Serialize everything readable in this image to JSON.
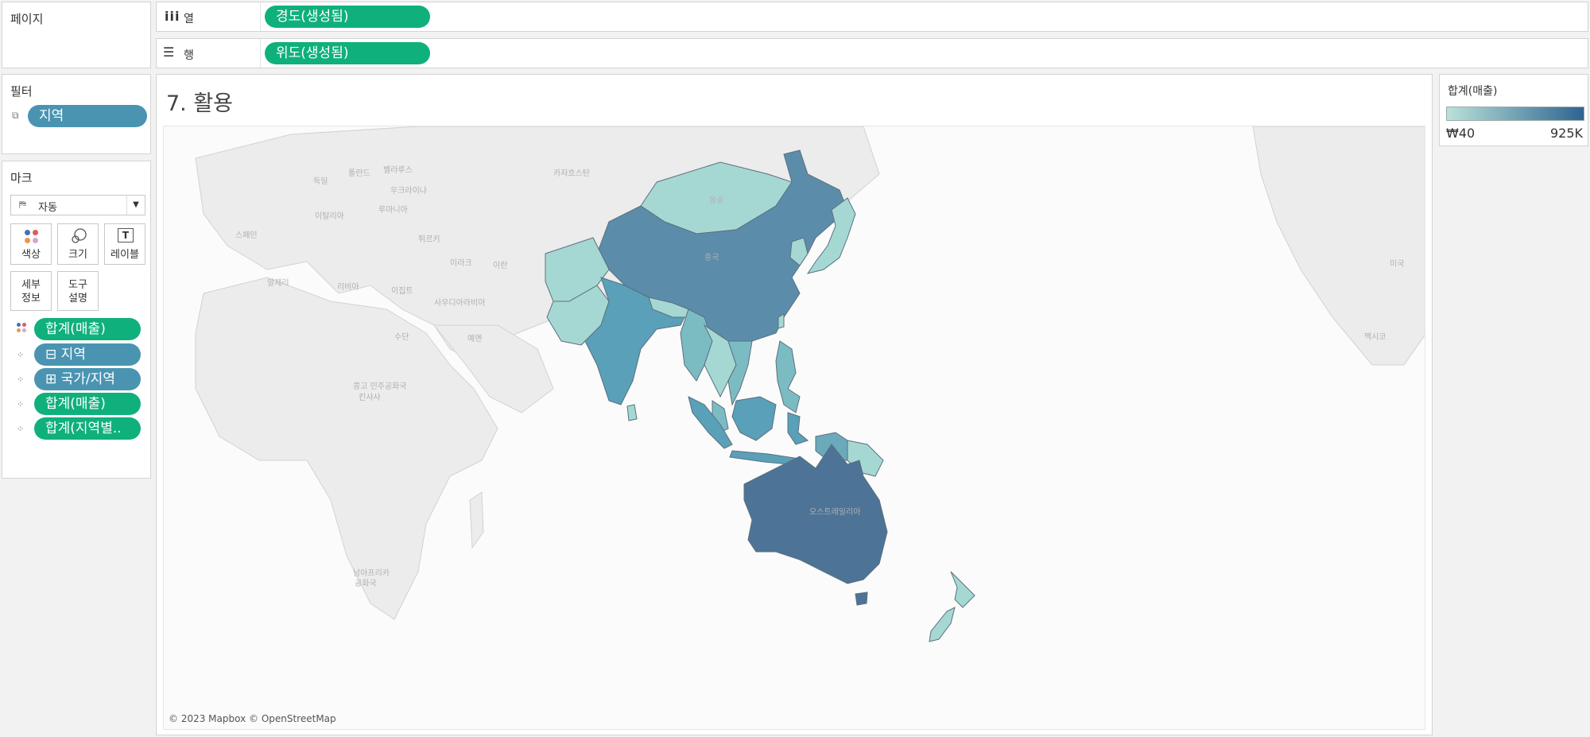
{
  "pages_panel": {
    "title": "페이지"
  },
  "shelves": {
    "columns": {
      "label": "열",
      "pill": "경도(생성됨)"
    },
    "rows": {
      "label": "행",
      "pill": "위도(생성됨)"
    }
  },
  "filters_panel": {
    "title": "필터",
    "pills": [
      "지역"
    ]
  },
  "marks_panel": {
    "title": "마크",
    "mark_type": "자동",
    "buttons": [
      {
        "label": "색상",
        "icon": "color-icon"
      },
      {
        "label": "크기",
        "icon": "size-icon"
      },
      {
        "label": "레이블",
        "icon": "label-icon"
      },
      {
        "label": "세부\n정보",
        "icon": "detail-icon"
      },
      {
        "label": "도구\n설명",
        "icon": "tooltip-icon"
      }
    ],
    "fields": [
      {
        "label": "합계(매출)",
        "kind": "color",
        "color": "green"
      },
      {
        "label": "⊟ 지역",
        "kind": "detail",
        "color": "blue"
      },
      {
        "label": "⊞ 국가/지역",
        "kind": "detail",
        "color": "blue"
      },
      {
        "label": "합계(매출)",
        "kind": "detail",
        "color": "green"
      },
      {
        "label": "합계(지역별..",
        "kind": "detail",
        "color": "green"
      }
    ]
  },
  "view": {
    "title": "7. 활용",
    "attribution": "© 2023 Mapbox © OpenStreetMap",
    "basemap_labels": [
      "독일",
      "폴란드",
      "벨라루스",
      "우크라이나",
      "루마니아",
      "이탈리아",
      "스페인",
      "튀르키",
      "알제리",
      "리비아",
      "이집트",
      "이라크",
      "이란",
      "사우디아라비아",
      "수단",
      "예멘",
      "콩고 민주공화국",
      "킨샤사",
      "남아프리카",
      "공화국",
      "카자흐스탄",
      "몽골",
      "중국",
      "오스트레일리아",
      "미국",
      "멕시코"
    ]
  },
  "legend": {
    "title": "합계(매출)",
    "min_label": "₩40",
    "max_label": "925K",
    "color_low": "#b9e2d9",
    "color_high": "#2f6490"
  },
  "colors": {
    "pill_green": "#0fb07c",
    "pill_blue": "#4a94b2",
    "very_high": "#4d7496",
    "high": "#5a8fac",
    "mid": "#6aaabb",
    "low": "#a6d8d3"
  }
}
